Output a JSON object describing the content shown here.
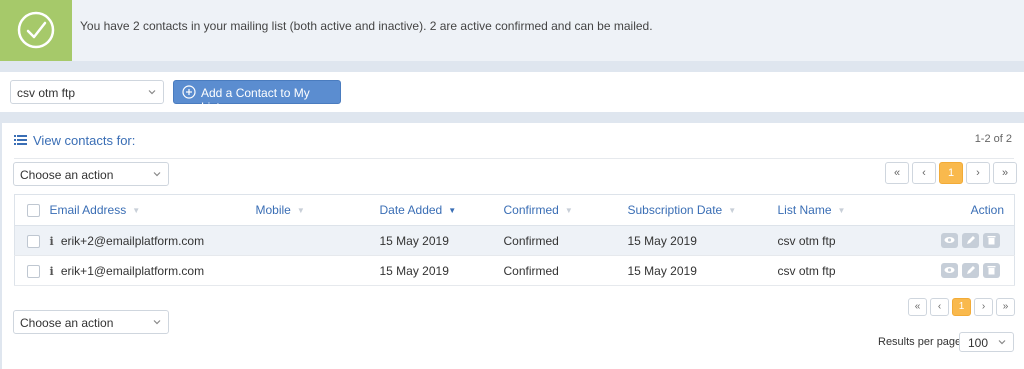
{
  "notice": {
    "message": "You have 2 contacts in your mailing list (both active and inactive). 2 are active confirmed and can be mailed."
  },
  "toolbar": {
    "list_select_value": "csv otm ftp",
    "add_button_label": "Add a Contact to My List..."
  },
  "panel": {
    "title": "View contacts for:",
    "count": "1-2 of 2"
  },
  "actions": {
    "top_select_value": "Choose an action",
    "bottom_select_value": "Choose an action"
  },
  "pager": {
    "first": "«",
    "prev": "‹",
    "current": "1",
    "next": "›",
    "last": "»"
  },
  "table": {
    "columns": [
      "Email Address",
      "Mobile",
      "Date Added",
      "Confirmed",
      "Subscription Date",
      "List Name",
      "Action"
    ],
    "rows": [
      {
        "info": "i",
        "email": "erik+2@emailplatform.com",
        "mobile": "",
        "date_added": "15 May 2019",
        "confirmed": "Confirmed",
        "subscription_date": "15 May 2019",
        "list_name": "csv otm ftp"
      },
      {
        "info": "i",
        "email": "erik+1@emailplatform.com",
        "mobile": "",
        "date_added": "15 May 2019",
        "confirmed": "Confirmed",
        "subscription_date": "15 May 2019",
        "list_name": "csv otm ftp"
      }
    ]
  },
  "results_per_page": {
    "label": "Results per page",
    "value": "100"
  },
  "colors": {
    "accent": "#3a6eb5",
    "success": "#a6c96a",
    "primary_button": "#5b8dd0",
    "active_page": "#f9b94d"
  },
  "icons": [
    "check-circle-icon",
    "plus-circle-icon",
    "chevron-down-icon",
    "list-icon",
    "sort-icon",
    "info-icon",
    "eye-icon",
    "pencil-icon",
    "trash-icon"
  ]
}
